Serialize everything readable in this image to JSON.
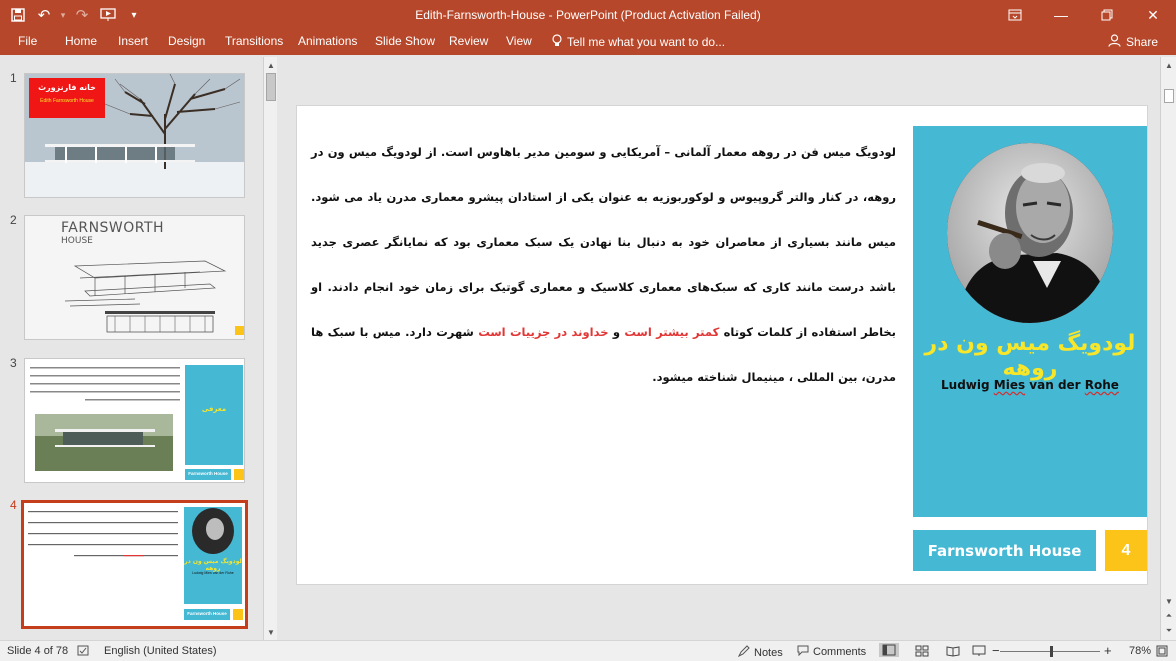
{
  "window": {
    "title": "Edith-Farnsworth-House - PowerPoint (Product Activation Failed)"
  },
  "ribbon": {
    "tabs": [
      "File",
      "Home",
      "Insert",
      "Design",
      "Transitions",
      "Animations",
      "Slide Show",
      "Review",
      "View"
    ],
    "tell_me": "Tell me what you want to do...",
    "share": "Share"
  },
  "thumbnails": [
    {
      "number": "1",
      "title": "خانه فارنزورث",
      "subtitle": "Edith Farnsworth House"
    },
    {
      "number": "2",
      "brand_top": "FARNSWORTH",
      "brand_bottom": "HOUSE"
    },
    {
      "number": "3",
      "panel_title": "معرفی",
      "footer": "Farnsworth House"
    },
    {
      "number": "4",
      "panel_title": "لودویگ میس ون در روهه",
      "panel_sub": "Ludwig Mies van der Rohe",
      "footer": "Farnsworth House"
    }
  ],
  "slide": {
    "heading": "لودویگ میس ون در روهه",
    "name_en_a": "Ludwig ",
    "name_en_b": "Mies",
    "name_en_c": " van der ",
    "name_en_d": "Rohe",
    "body_1": "لودویگ میس فن در روهه معمار آلمانی – آمریکایی و سومین مدیر باهاوس است. از لودویگ میس ون در روهه، در کنار والتر گروپیوس و لوکوربوزیه به عنوان یکی از استادان پیشرو معماری مدرن یاد می شود. میس مانند بسیاری از معاصران خود به دنبال بنا نهادن یک سبک معماری بود که نمایانگر عصری جدید باشد درست مانند کاری که سبک‌های معماری کلاسیک و معماری گوتیک برای زمان خود انجام دادند. او بخاطر استفاده از کلمات کوتاه ",
    "body_red_1": "کمتر بیشتر است",
    "body_2": " و ",
    "body_red_2": "خداوند در جزییات است",
    "body_3": " شهرت دارد. میس با سبک ها مدرن، بین المللی ، مینیمال شناخته میشود.",
    "footer": "Farnsworth House",
    "page_number": "4"
  },
  "status": {
    "slide_info": "Slide 4 of 78",
    "language": "English (United States)",
    "notes": "Notes",
    "comments": "Comments",
    "zoom": "78%"
  },
  "colors": {
    "accent": "#b7472a",
    "panel": "#45b8d4",
    "heading_yellow": "#f7e62a",
    "page_num": "#fcc419",
    "red_text": "#e23636"
  }
}
